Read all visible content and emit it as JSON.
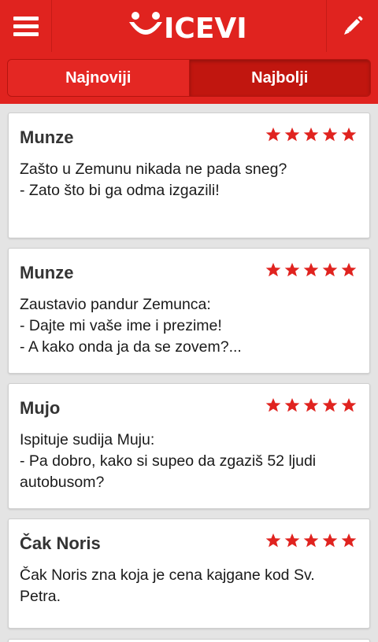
{
  "app": {
    "logo_text": "VICEVI",
    "accent": "#e0231f",
    "star_color": "#e0231f"
  },
  "tabs": [
    {
      "label": "Najnoviji",
      "selected": false
    },
    {
      "label": "Najbolji",
      "selected": true
    }
  ],
  "jokes": [
    {
      "author": "Munze",
      "rating": 5,
      "text": "Zašto u Zemunu nikada ne pada sneg?\n- Zato što bi ga odma izgazili!"
    },
    {
      "author": "Munze",
      "rating": 5,
      "text": "Zaustavio pandur Zemunca:\n- Dajte mi vaše ime i prezime!\n- A kako onda ja da se zovem?..."
    },
    {
      "author": "Mujo",
      "rating": 5,
      "text": "Ispituje sudija Muju:\n- Pa dobro, kako si supeo da zgaziš 52 ljudi autobusom?"
    },
    {
      "author": "Čak Noris",
      "rating": 5,
      "text": "Čak Noris zna koja je cena kajgane kod Sv. Petra."
    }
  ]
}
